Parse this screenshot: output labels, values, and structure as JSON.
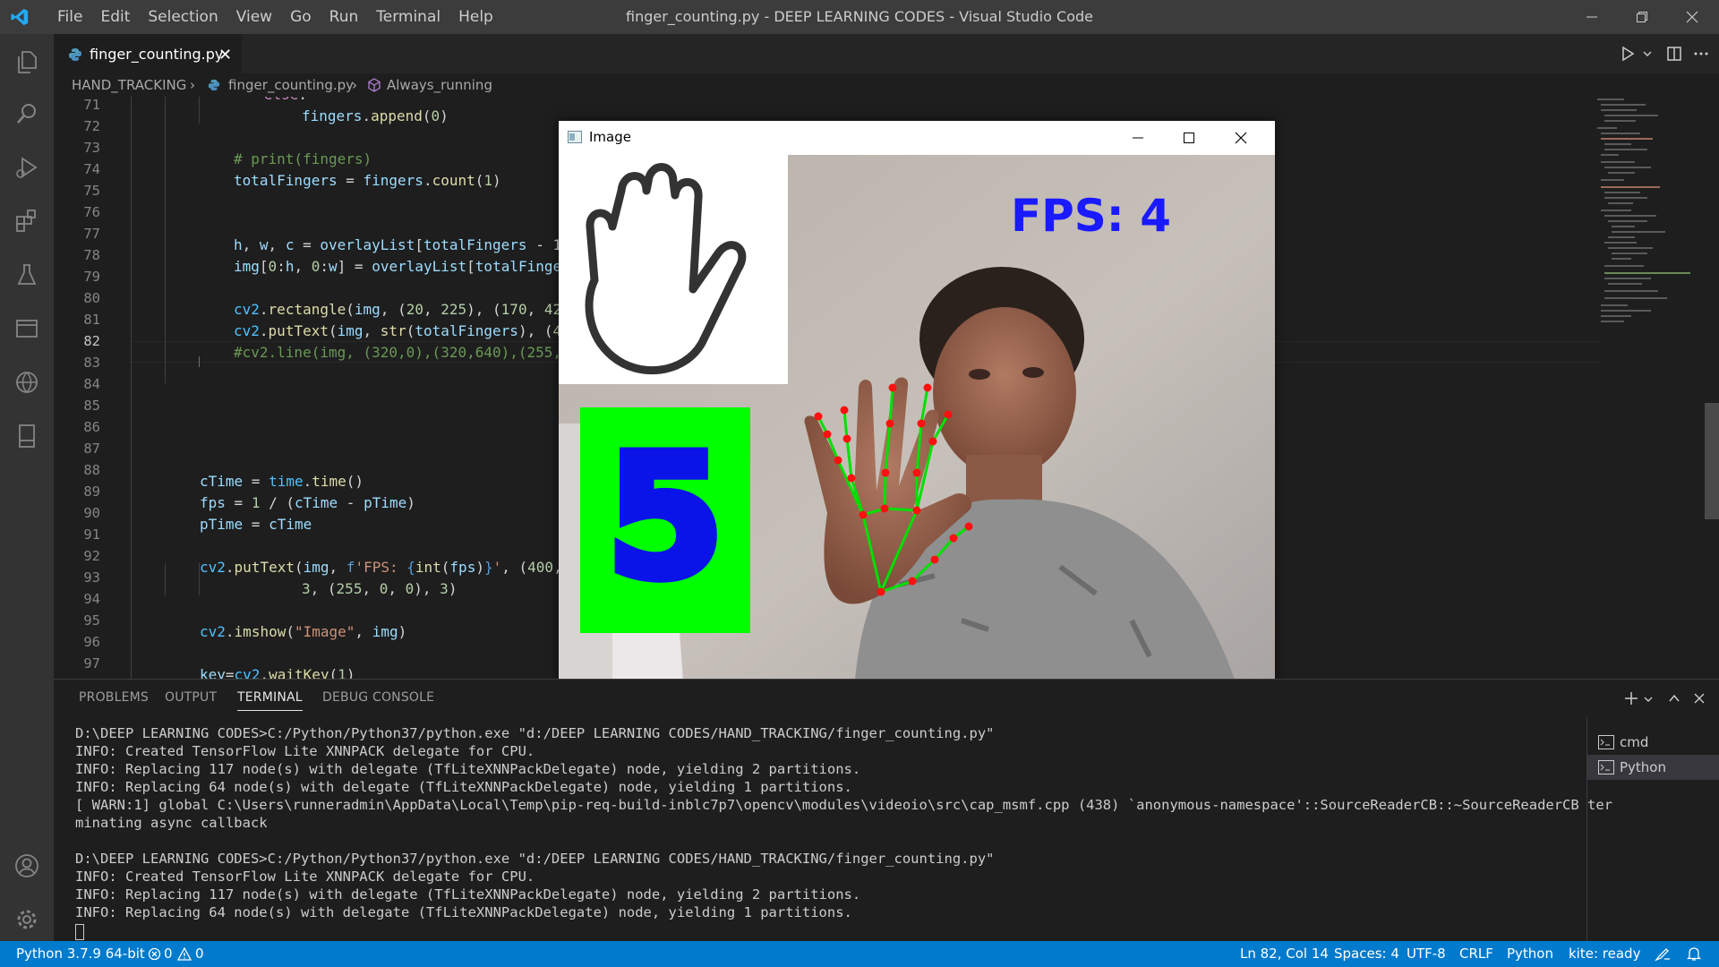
{
  "window": {
    "title": "finger_counting.py - DEEP LEARNING CODES - Visual Studio Code",
    "menu": [
      "File",
      "Edit",
      "Selection",
      "View",
      "Go",
      "Run",
      "Terminal",
      "Help"
    ]
  },
  "tab": {
    "label": "finger_counting.py",
    "close": "✕"
  },
  "breadcrumb": {
    "folder": "HAND_TRACKING",
    "file": "finger_counting.py",
    "symbol": "Always_running",
    "sep1": "›",
    "sep2": "›"
  },
  "editor": {
    "line_numbers": [
      "71",
      "72",
      "73",
      "74",
      "75",
      "76",
      "77",
      "78",
      "79",
      "80",
      "81",
      "82",
      "83",
      "84",
      "85",
      "86",
      "87",
      "88",
      "89",
      "90",
      "91",
      "92",
      "93",
      "94",
      "95",
      "96",
      "97"
    ],
    "current_line": "82"
  },
  "image_window": {
    "title": "Image",
    "fps_text": "FPS: 4",
    "finger_count": "5"
  },
  "panel": {
    "tabs": [
      "PROBLEMS",
      "OUTPUT",
      "TERMINAL",
      "DEBUG CONSOLE"
    ],
    "active_tab": "TERMINAL",
    "terminal_lines": [
      "D:\\DEEP LEARNING CODES>C:/Python/Python37/python.exe \"d:/DEEP LEARNING CODES/HAND_TRACKING/finger_counting.py\"",
      "INFO: Created TensorFlow Lite XNNPACK delegate for CPU.",
      "INFO: Replacing 117 node(s) with delegate (TfLiteXNNPackDelegate) node, yielding 2 partitions.",
      "INFO: Replacing 64 node(s) with delegate (TfLiteXNNPackDelegate) node, yielding 1 partitions.",
      "[ WARN:1] global C:\\Users\\runneradmin\\AppData\\Local\\Temp\\pip-req-build-inblc7p7\\opencv\\modules\\videoio\\src\\cap_msmf.cpp (438) `anonymous-namespace'::SourceReaderCB::~SourceReaderCB ter",
      "minating async callback",
      "",
      "D:\\DEEP LEARNING CODES>C:/Python/Python37/python.exe \"d:/DEEP LEARNING CODES/HAND_TRACKING/finger_counting.py\"",
      "INFO: Created TensorFlow Lite XNNPACK delegate for CPU.",
      "INFO: Replacing 117 node(s) with delegate (TfLiteXNNPackDelegate) node, yielding 2 partitions.",
      "INFO: Replacing 64 node(s) with delegate (TfLiteXNNPackDelegate) node, yielding 1 partitions."
    ],
    "terminals": [
      "cmd",
      "Python"
    ],
    "active_terminal": "Python"
  },
  "status": {
    "interpreter": "Python 3.7.9 64-bit",
    "errors": "0",
    "warnings": "0",
    "position": "Ln 82, Col 14",
    "spaces": "Spaces: 4",
    "encoding": "UTF-8",
    "eol": "CRLF",
    "language": "Python",
    "kite": "kite: ready"
  },
  "colors": {
    "statusbar": "#007acc",
    "activitybar": "#333333",
    "editor_bg": "#1e1e1e",
    "accent_green": "#00ff00",
    "fps_text": "#1a1aff"
  }
}
